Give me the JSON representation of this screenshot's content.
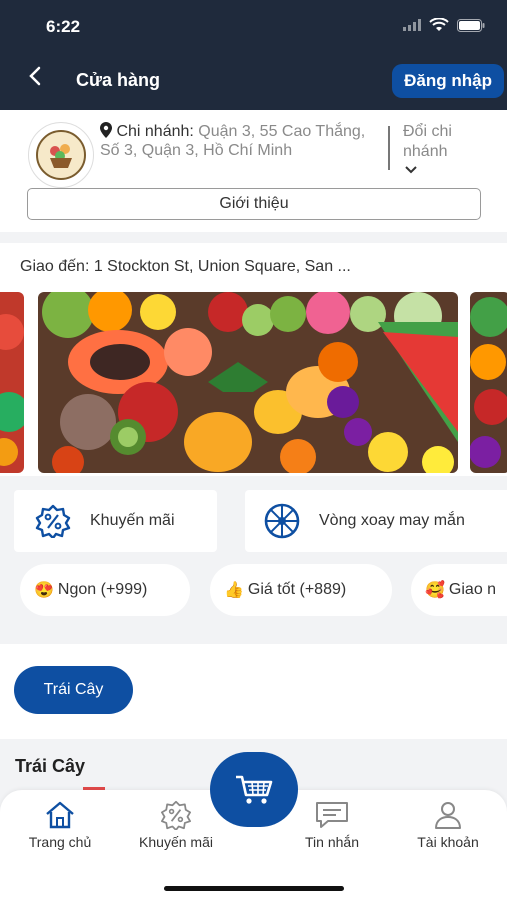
{
  "status_bar": {
    "time": "6:22"
  },
  "header": {
    "title": "Cửa hàng",
    "login_label": "Đăng nhập"
  },
  "store": {
    "branch_label": "Chi nhánh:",
    "branch_address": "Quận 3, 55 Cao Thắng, Số 3, Quận 3, Hồ Chí Minh",
    "change_branch_label": "Đổi chi nhánh",
    "intro_label": "Giới thiệu"
  },
  "delivery": {
    "text": "Giao đến: 1 Stockton St, Union Square, San ..."
  },
  "features": [
    {
      "label": "Khuyến mãi",
      "icon": "discount-icon"
    },
    {
      "label": "Vòng xoay may mắn",
      "icon": "wheel-icon"
    }
  ],
  "tags": [
    {
      "emoji": "😍",
      "label": "Ngon (+999)"
    },
    {
      "emoji": "👍",
      "label": "Giá tốt (+889)"
    },
    {
      "emoji": "🥰",
      "label": "Giao n"
    }
  ],
  "category": {
    "active_label": "Trái Cây"
  },
  "section": {
    "title": "Trái Cây"
  },
  "bottom_nav": {
    "items": [
      {
        "label": "Trang chủ",
        "icon": "home-icon"
      },
      {
        "label": "Khuyến mãi",
        "icon": "discount-icon"
      },
      {
        "label": "Tin nhắn",
        "icon": "message-icon"
      },
      {
        "label": "Tài khoản",
        "icon": "account-icon"
      }
    ],
    "cart_icon": "cart-icon"
  },
  "colors": {
    "header_bg": "#1f2a3c",
    "accent": "#0e4fa2",
    "home_active": "#0e4fa2",
    "underline": "#e24a4a"
  }
}
